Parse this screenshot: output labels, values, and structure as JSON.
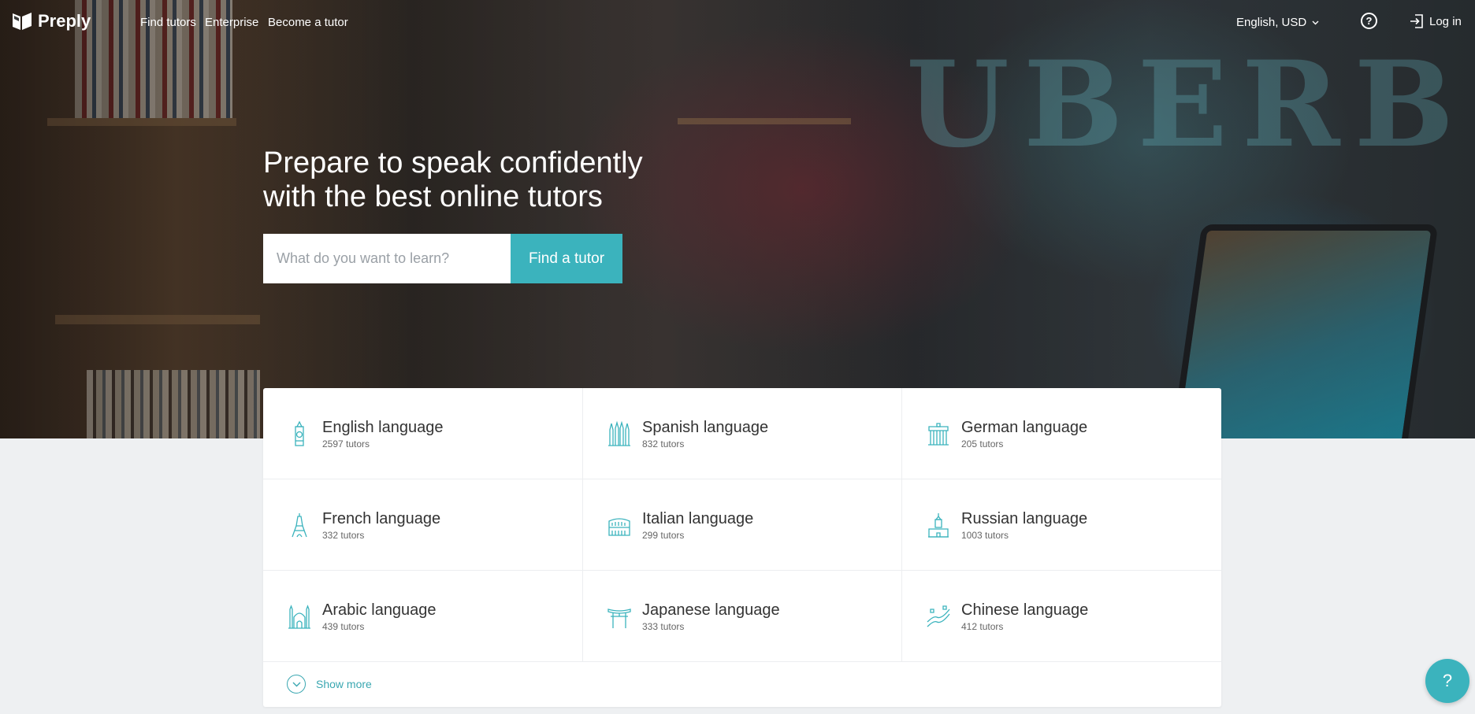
{
  "header": {
    "brand": "Preply",
    "nav": [
      "Find tutors",
      "Enterprise",
      "Become a tutor"
    ],
    "language_currency": "English, USD",
    "help_icon": "question-circle-icon",
    "login_label": "Log in"
  },
  "hero": {
    "headline_line1": "Prepare to speak confidently",
    "headline_line2": "with the best online tutors",
    "search_placeholder": "What do you want to learn?",
    "search_button": "Find a tutor"
  },
  "languages": [
    {
      "name": "English language",
      "count": "2597 tutors",
      "icon": "big-ben-icon"
    },
    {
      "name": "Spanish language",
      "count": "832 tutors",
      "icon": "sagrada-familia-icon"
    },
    {
      "name": "German language",
      "count": "205 tutors",
      "icon": "brandenburg-gate-icon"
    },
    {
      "name": "French language",
      "count": "332 tutors",
      "icon": "eiffel-tower-icon"
    },
    {
      "name": "Italian language",
      "count": "299 tutors",
      "icon": "colosseum-icon"
    },
    {
      "name": "Russian language",
      "count": "1003 tutors",
      "icon": "kremlin-icon"
    },
    {
      "name": "Arabic language",
      "count": "439 tutors",
      "icon": "mosque-icon"
    },
    {
      "name": "Japanese language",
      "count": "333 tutors",
      "icon": "torii-gate-icon"
    },
    {
      "name": "Chinese language",
      "count": "412 tutors",
      "icon": "great-wall-icon"
    }
  ],
  "show_more": "Show more",
  "help_button": "?",
  "colors": {
    "accent": "#3bb3bd",
    "accent_text": "#3aa7b1",
    "page_bg": "#eef0f2"
  }
}
